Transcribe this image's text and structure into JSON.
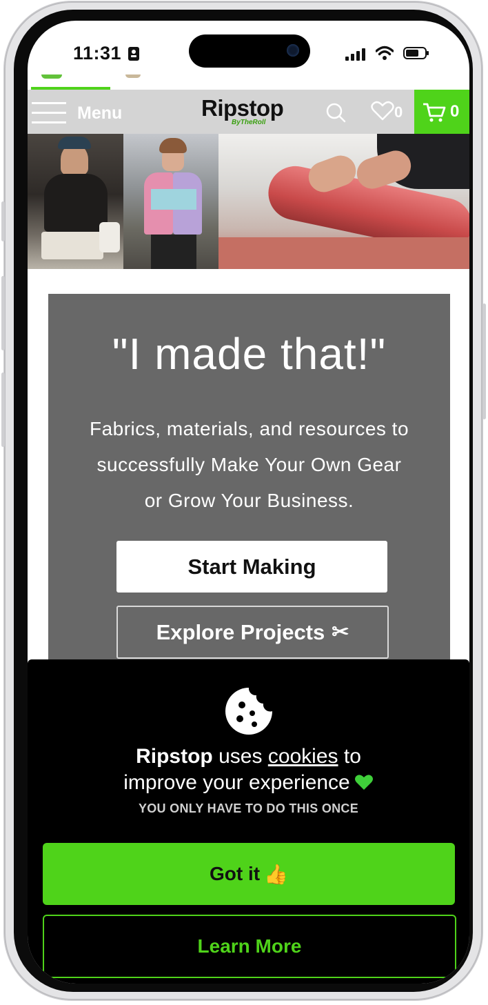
{
  "status_bar": {
    "time": "11:31"
  },
  "header": {
    "menu_label": "Menu",
    "logo_main": "Ripstop",
    "logo_sub": "ByTheRoll",
    "wishlist_count": "0",
    "cart_count": "0",
    "accent_color": "#4fd31a"
  },
  "promo": {
    "title": "\"I made that!\"",
    "line1": "Fabrics, materials, and resources to",
    "line2": "successfully Make Your Own Gear",
    "line3": "or Grow Your Business.",
    "start_button": "Start Making",
    "explore_button": "Explore Projects",
    "explore_icon": "scissors-icon"
  },
  "cookie_banner": {
    "brand": "Ripstop",
    "text_a": " uses ",
    "link": "cookies",
    "text_b": " to",
    "line2": "improve your experience",
    "note": "YOU ONLY HAVE TO DO THIS ONCE",
    "accept_button": "Got it",
    "learn_button": "Learn More"
  }
}
